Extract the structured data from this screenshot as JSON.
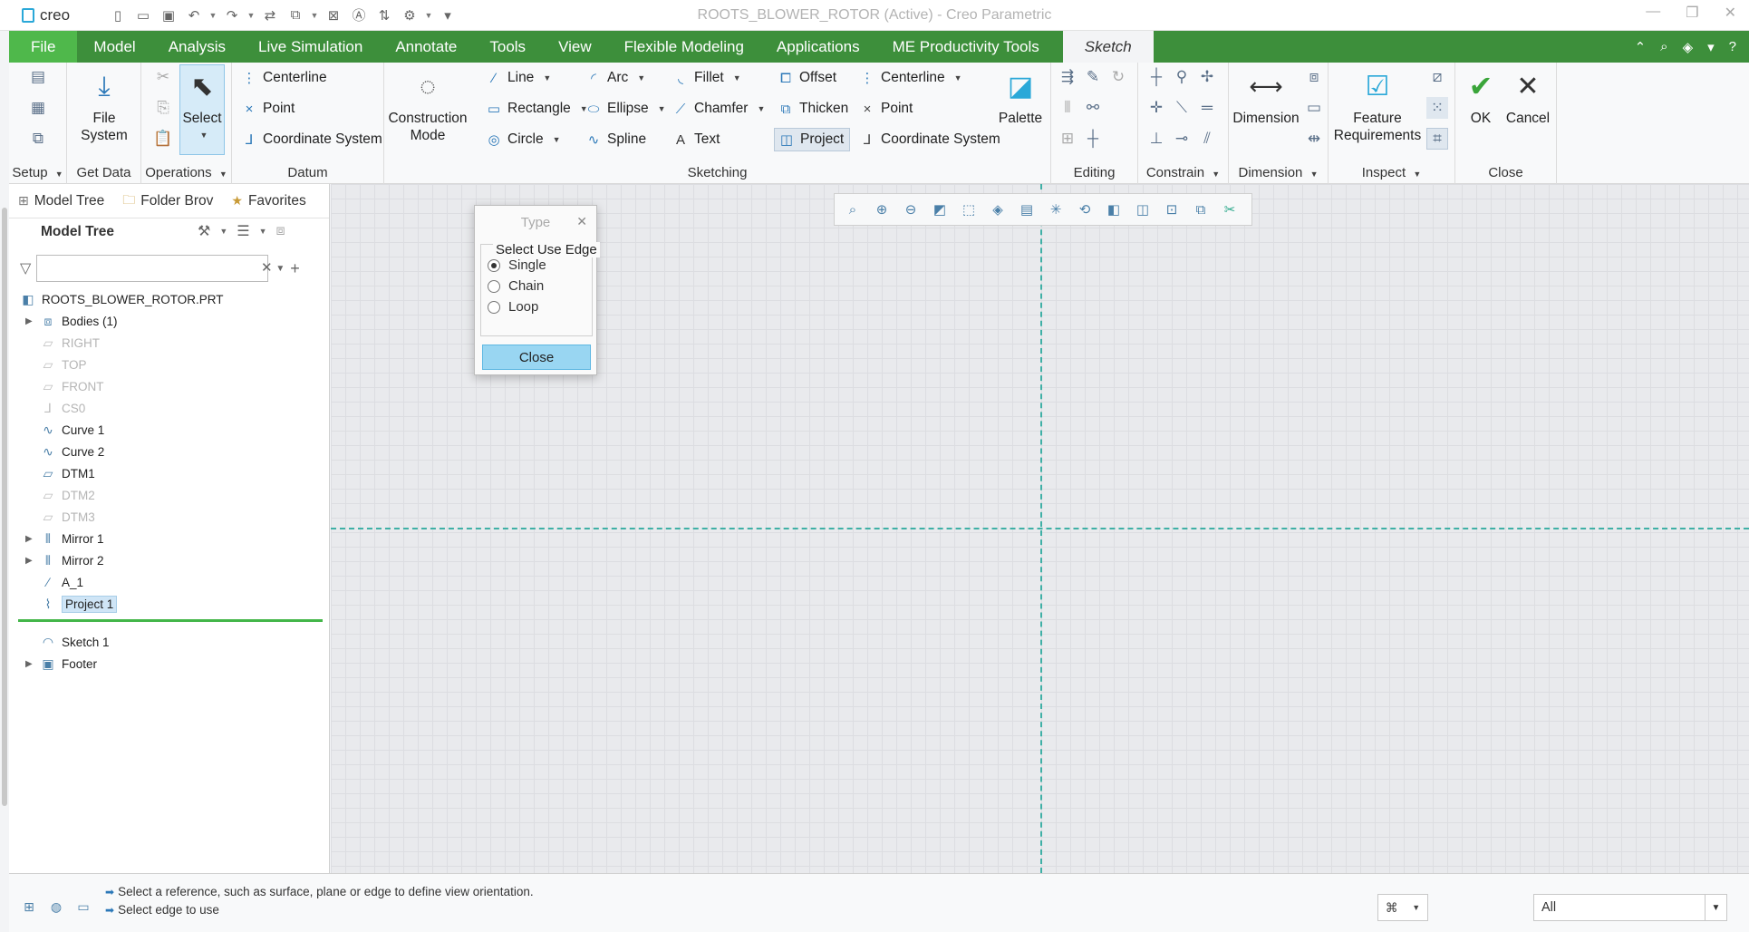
{
  "app": {
    "logo": "creo",
    "window_title": "ROOTS_BLOWER_ROTOR (Active) - Creo Parametric"
  },
  "menu": {
    "items": [
      "File",
      "Model",
      "Analysis",
      "Live Simulation",
      "Annotate",
      "Tools",
      "View",
      "Flexible Modeling",
      "Applications",
      "ME Productivity Tools",
      "Sketch"
    ],
    "active": "Sketch"
  },
  "ribbon": {
    "groups": {
      "setup": "Setup",
      "get_data": "Get Data",
      "operations": "Operations",
      "datum": "Datum",
      "sketching": "Sketching",
      "editing": "Editing",
      "constrain": "Constrain",
      "dimension": "Dimension",
      "inspect": "Inspect",
      "close": "Close"
    },
    "file_system": [
      "File",
      "System"
    ],
    "select": "Select",
    "datum_items": [
      "Centerline",
      "Point",
      "Coordinate System"
    ],
    "construction_mode": [
      "Construction",
      "Mode"
    ],
    "sketch_col1": [
      "Line",
      "Rectangle",
      "Circle"
    ],
    "sketch_col2": [
      "Arc",
      "Ellipse",
      "Spline"
    ],
    "sketch_col3": [
      "Fillet",
      "Chamfer",
      "Text"
    ],
    "sketch_col4": [
      "Offset",
      "Thicken",
      "Project"
    ],
    "sketch_col5": [
      "Centerline",
      "Point",
      "Coordinate System"
    ],
    "palette": "Palette",
    "dimension_btn": "Dimension",
    "feature_requirements": [
      "Feature",
      "Requirements"
    ],
    "ok": "OK",
    "cancel": "Cancel"
  },
  "left_panel": {
    "tabs": [
      "Model Tree",
      "Folder Brov",
      "Favorites"
    ],
    "header": "Model Tree",
    "search_placeholder": "",
    "tree": [
      {
        "label": "ROOTS_BLOWER_ROTOR.PRT",
        "icon": "part-icon",
        "expand": false,
        "dim": false,
        "indent": 0
      },
      {
        "label": "Bodies (1)",
        "icon": "bodies-icon",
        "expand": true,
        "dim": false,
        "indent": 1
      },
      {
        "label": "RIGHT",
        "icon": "datum-plane-icon",
        "expand": false,
        "dim": true,
        "indent": 1
      },
      {
        "label": "TOP",
        "icon": "datum-plane-icon",
        "expand": false,
        "dim": true,
        "indent": 1
      },
      {
        "label": "FRONT",
        "icon": "datum-plane-icon",
        "expand": false,
        "dim": true,
        "indent": 1
      },
      {
        "label": "CS0",
        "icon": "coordinate-system-icon",
        "expand": false,
        "dim": true,
        "indent": 1
      },
      {
        "label": "Curve 1",
        "icon": "curve-icon",
        "expand": false,
        "dim": false,
        "indent": 1
      },
      {
        "label": "Curve 2",
        "icon": "curve-icon",
        "expand": false,
        "dim": false,
        "indent": 1
      },
      {
        "label": "DTM1",
        "icon": "datum-plane-icon",
        "expand": false,
        "dim": false,
        "indent": 1
      },
      {
        "label": "DTM2",
        "icon": "datum-plane-icon",
        "expand": false,
        "dim": true,
        "indent": 1
      },
      {
        "label": "DTM3",
        "icon": "datum-plane-icon",
        "expand": false,
        "dim": true,
        "indent": 1
      },
      {
        "label": "Mirror 1",
        "icon": "mirror-icon",
        "expand": true,
        "dim": false,
        "indent": 1
      },
      {
        "label": "Mirror 2",
        "icon": "mirror-icon",
        "expand": true,
        "dim": false,
        "indent": 1
      },
      {
        "label": "A_1",
        "icon": "axis-icon",
        "expand": false,
        "dim": false,
        "indent": 1
      },
      {
        "label": "Project 1",
        "icon": "project-icon",
        "expand": false,
        "dim": false,
        "indent": 1,
        "highlight": true
      },
      {
        "label": "Sketch 1",
        "icon": "sketch-icon",
        "expand": false,
        "dim": false,
        "indent": 1
      },
      {
        "label": "Footer",
        "icon": "footer-icon",
        "expand": true,
        "dim": false,
        "indent": 1
      }
    ]
  },
  "dialog": {
    "title": "Type",
    "legend": "Select Use Edge",
    "options": [
      "Single",
      "Chain",
      "Loop"
    ],
    "selected": "Single",
    "close_button": "Close"
  },
  "status": {
    "messages": [
      "Select a reference, such as surface, plane or edge to define view orientation.",
      "Select edge to use"
    ],
    "filter_value": "All"
  }
}
